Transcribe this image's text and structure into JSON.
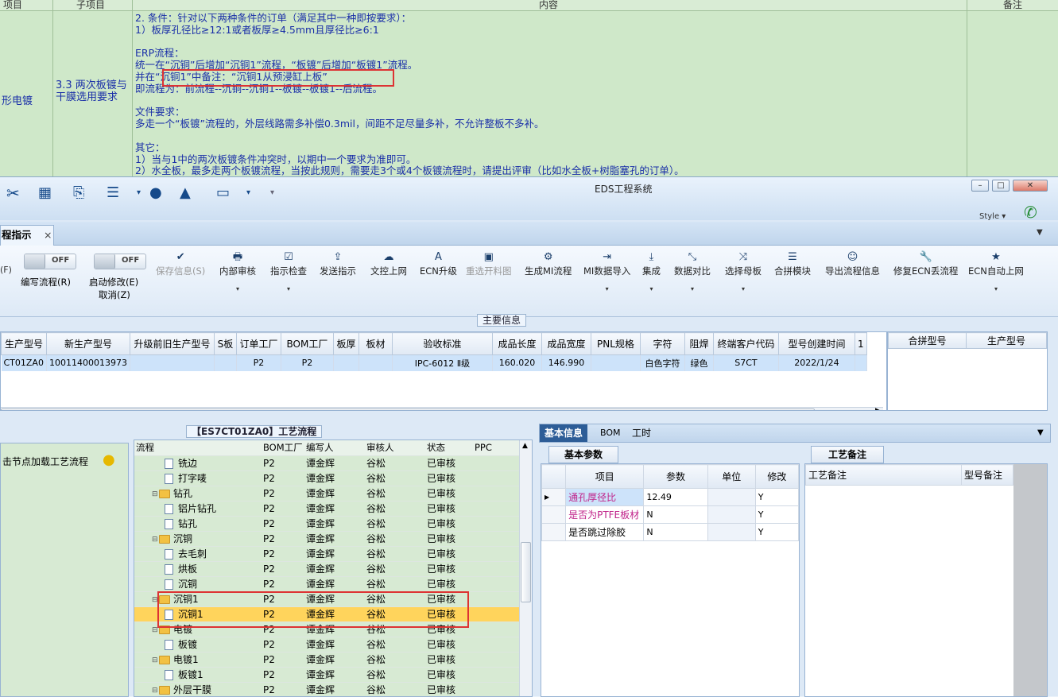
{
  "doc": {
    "headers": [
      "项目",
      "子项目",
      "内容",
      "备注"
    ],
    "category": "形电镀",
    "subitem": "3.3 两次板镀与干膜选用要求",
    "lines": [
      "2. 条件：针对以下两种条件的订单（满足其中一种即按要求）：",
      "1）板厚孔径比≥12:1或者板厚≥4.5mm且厚径比≥6:1",
      "",
      "ERP流程：",
      "统一在“沉铜”后增加“沉铜1”流程，“板镀”后增加“板镀1”流程。",
      "并在“沉铜1”中备注：“沉铜1从预浸缸上板”",
      "即流程为：前流程--沉铜--沉铜1--板镀--板镀1--后流程。",
      "",
      "文件要求：",
      "多走一个“板镀”流程的，外层线路需多补偿0.3mil，间距不足尽量多补，不允许整板不多补。",
      "",
      "其它：",
      "1）当与1中的两次板镀条件冲突时，以期中一个要求为准即可。",
      "2）水全板，最多走两个板镀流程，当按此规则，需要走3个或4个板镀流程时，请提出评审（比如水全板+树脂塞孔的订单）。"
    ]
  },
  "window": {
    "title": "EDS工程系统",
    "style_label": "Style ▾",
    "tab_label": "程指示",
    "tab_close": "×"
  },
  "ribbon": {
    "paren_f": "(F)",
    "toggle_off": "OFF",
    "edit_flow": "编写流程(R)",
    "start_modify": "启动修改(E)",
    "cancel": "取消(Z)",
    "buttons": [
      {
        "label": "保存信息(S)",
        "icon": "✔"
      },
      {
        "label": "内部审核",
        "icon": "🖶"
      },
      {
        "label": "指示检查",
        "icon": "☑"
      },
      {
        "label": "发送指示",
        "icon": "⇪"
      },
      {
        "label": "文控上网",
        "icon": "☁"
      },
      {
        "label": "ECN升级",
        "icon": "A"
      },
      {
        "label": "重选开料图",
        "icon": "▣"
      },
      {
        "label": "生成MI流程",
        "icon": "⚙"
      },
      {
        "label": "MI数据导入",
        "icon": "⇥"
      },
      {
        "label": "集成",
        "icon": "⤓"
      },
      {
        "label": "数据对比",
        "icon": "⤡"
      },
      {
        "label": "选择母板",
        "icon": "⤨"
      },
      {
        "label": "合拼模块",
        "icon": "☰"
      },
      {
        "label": "导出流程信息",
        "icon": "☺"
      },
      {
        "label": "修复ECN丢流程",
        "icon": "🔧"
      },
      {
        "label": "ECN自动上网",
        "icon": "★"
      }
    ]
  },
  "main_info": {
    "section_title": "主要信息",
    "columns": [
      "生产型号",
      "新生产型号",
      "升级前旧生产型号",
      "S板",
      "订单工厂",
      "BOM工厂",
      "板厚",
      "板材",
      "验收标准",
      "成品长度",
      "成品宽度",
      "PNL规格",
      "字符",
      "阻焊",
      "终端客户代码",
      "型号创建时间",
      "1"
    ],
    "row": [
      "CT01ZA0",
      "10011400013973",
      "",
      "",
      "P2",
      "P2",
      "",
      "",
      "IPC-6012 Ⅱ级",
      "160.020",
      "146.990",
      "",
      "白色字符",
      "绿色",
      "S7CT",
      "2022/1/24",
      ""
    ],
    "side_columns": [
      "合拼型号",
      "生产型号"
    ]
  },
  "left_panel": {
    "hint": "击节点加载工艺流程"
  },
  "flow": {
    "title": "【ES7CT01ZA0】工艺流程",
    "columns": [
      "流程",
      "BOM工厂",
      "编写人",
      "审核人",
      "状态",
      "PPC"
    ],
    "rows": [
      {
        "name": "铣边",
        "type": "file",
        "bom": "P2",
        "writer": "谭金辉",
        "checker": "谷松",
        "status": "已审核"
      },
      {
        "name": "打字唛",
        "type": "file",
        "bom": "P2",
        "writer": "谭金辉",
        "checker": "谷松",
        "status": "已审核"
      },
      {
        "name": "钻孔",
        "type": "folder",
        "bom": "P2",
        "writer": "谭金辉",
        "checker": "谷松",
        "status": "已审核"
      },
      {
        "name": "铝片钻孔",
        "type": "file",
        "bom": "P2",
        "writer": "谭金辉",
        "checker": "谷松",
        "status": "已审核"
      },
      {
        "name": "钻孔",
        "type": "file",
        "bom": "P2",
        "writer": "谭金辉",
        "checker": "谷松",
        "status": "已审核"
      },
      {
        "name": "沉铜",
        "type": "folder",
        "bom": "P2",
        "writer": "谭金辉",
        "checker": "谷松",
        "status": "已审核"
      },
      {
        "name": "去毛刺",
        "type": "file",
        "bom": "P2",
        "writer": "谭金辉",
        "checker": "谷松",
        "status": "已审核"
      },
      {
        "name": "烘板",
        "type": "file",
        "bom": "P2",
        "writer": "谭金辉",
        "checker": "谷松",
        "status": "已审核"
      },
      {
        "name": "沉铜",
        "type": "file",
        "bom": "P2",
        "writer": "谭金辉",
        "checker": "谷松",
        "status": "已审核"
      },
      {
        "name": "沉铜1",
        "type": "folder",
        "bom": "P2",
        "writer": "谭金辉",
        "checker": "谷松",
        "status": "已审核"
      },
      {
        "name": "沉铜1",
        "type": "file",
        "bom": "P2",
        "writer": "谭金辉",
        "checker": "谷松",
        "status": "已审核",
        "highlight": true
      },
      {
        "name": "电镀",
        "type": "folder",
        "bom": "P2",
        "writer": "谭金辉",
        "checker": "谷松",
        "status": "已审核"
      },
      {
        "name": "板镀",
        "type": "file",
        "bom": "P2",
        "writer": "谭金辉",
        "checker": "谷松",
        "status": "已审核"
      },
      {
        "name": "电镀1",
        "type": "folder",
        "bom": "P2",
        "writer": "谭金辉",
        "checker": "谷松",
        "status": "已审核"
      },
      {
        "name": "板镀1",
        "type": "file",
        "bom": "P2",
        "writer": "谭金辉",
        "checker": "谷松",
        "status": "已审核"
      },
      {
        "name": "外层干膜",
        "type": "folder",
        "bom": "P2",
        "writer": "谭金辉",
        "checker": "谷松",
        "status": "已审核"
      }
    ]
  },
  "basic": {
    "tabs": [
      "基本信息",
      "BOM",
      "工时"
    ],
    "subtab": "基本参数",
    "columns": [
      "项目",
      "参数",
      "单位",
      "修改"
    ],
    "rows": [
      {
        "item": "通孔厚径比",
        "param": "12.49",
        "unit": "",
        "mod": "Y"
      },
      {
        "item": "是否为PTFE板材",
        "param": "N",
        "unit": "",
        "mod": "Y"
      },
      {
        "item": "是否跳过除胶",
        "param": "N",
        "unit": "",
        "mod": "Y"
      }
    ],
    "remark_tab": "工艺备注",
    "remark_columns": [
      "工艺备注",
      "型号备注"
    ]
  },
  "colors": {
    "doc_bg": "#cfe8c9",
    "doc_text": "#1a2fa8",
    "highlight_row": "#ffd45c",
    "annotation_red": "#d33",
    "magenta_item": "#c0238a"
  }
}
